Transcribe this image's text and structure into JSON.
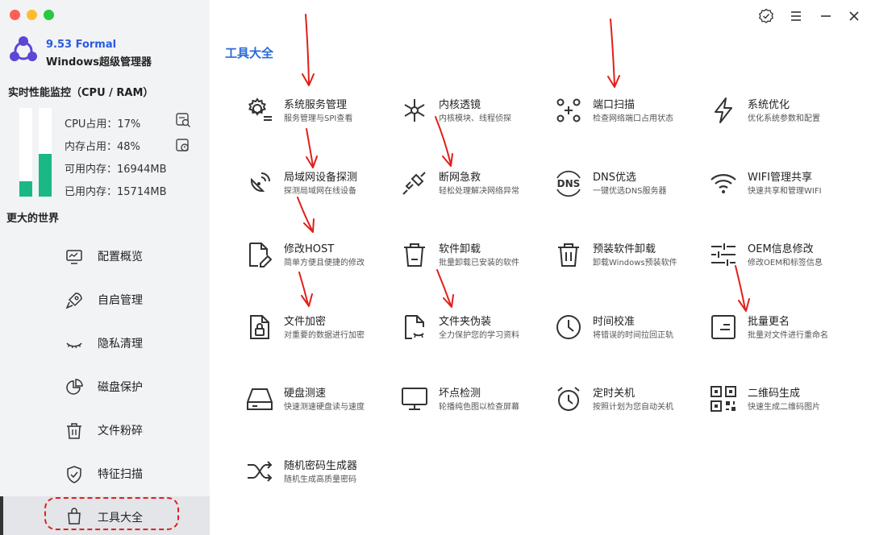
{
  "app": {
    "version": "9.53 Formal",
    "name": "Windows超级管理器"
  },
  "monitor": {
    "title": "实时性能监控（CPU / RAM）",
    "cpu_label": "CPU占用：17%",
    "cpu_percent": 17,
    "mem_label": "内存占用：48%",
    "mem_percent": 48,
    "avail_label": "可用内存：16944MB",
    "used_label": "已用内存：15714MB",
    "bar_color": "#1ab884"
  },
  "sidebar": {
    "section": "更大的世界",
    "items": [
      {
        "label": "配置概览",
        "icon": "monitor-icon"
      },
      {
        "label": "自启管理",
        "icon": "rocket-icon"
      },
      {
        "label": "隐私清理",
        "icon": "closed-eye-icon"
      },
      {
        "label": "磁盘保护",
        "icon": "pie-chart-icon"
      },
      {
        "label": "文件粉碎",
        "icon": "trash-icon"
      },
      {
        "label": "特征扫描",
        "icon": "shield-check-icon"
      },
      {
        "label": "工具大全",
        "icon": "bag-icon",
        "active": true
      }
    ]
  },
  "main": {
    "title": "工具大全",
    "tools": [
      {
        "name": "系统服务管理",
        "desc": "服务管理与SPI查看",
        "icon": "gear-list-icon"
      },
      {
        "name": "内核透镜",
        "desc": "内核模块、线程侦探",
        "icon": "kernel-icon"
      },
      {
        "name": "端口扫描",
        "desc": "检查网络端口占用状态",
        "icon": "port-scan-icon"
      },
      {
        "name": "系统优化",
        "desc": "优化系统参数和配置",
        "icon": "lightning-icon"
      },
      {
        "name": "局域网设备探测",
        "desc": "探测局域网在线设备",
        "icon": "satellite-icon"
      },
      {
        "name": "断网急救",
        "desc": "轻松处理解决网络异常",
        "icon": "plug-icon"
      },
      {
        "name": "DNS优选",
        "desc": "一键优选DNS服务器",
        "icon": "dns-icon"
      },
      {
        "name": "WIFI管理共享",
        "desc": "快速共享和管理WIFI",
        "icon": "wifi-icon"
      },
      {
        "name": "修改HOST",
        "desc": "简单方便且便捷的修改",
        "icon": "file-edit-icon"
      },
      {
        "name": "软件卸载",
        "desc": "批量卸载已安装的软件",
        "icon": "bin-icon"
      },
      {
        "name": "预装软件卸载",
        "desc": "卸载Windows预装软件",
        "icon": "bin-lines-icon"
      },
      {
        "name": "OEM信息修改",
        "desc": "修改OEM和标签信息",
        "icon": "sliders-icon"
      },
      {
        "name": "文件加密",
        "desc": "对重要的数据进行加密",
        "icon": "file-lock-icon"
      },
      {
        "name": "文件夹伪装",
        "desc": "全力保护您的学习资料",
        "icon": "file-mask-icon"
      },
      {
        "name": "时间校准",
        "desc": "将错误的时间拉回正轨",
        "icon": "clock-icon"
      },
      {
        "name": "批量更名",
        "desc": "批量对文件进行重命名",
        "icon": "rename-icon"
      },
      {
        "name": "硬盘测速",
        "desc": "快速测速硬盘读与速度",
        "icon": "harddisk-icon"
      },
      {
        "name": "坏点检测",
        "desc": "轮播纯色图以检查屏幕",
        "icon": "screen-icon"
      },
      {
        "name": "定时关机",
        "desc": "按照计划为您自动关机",
        "icon": "alarm-icon"
      },
      {
        "name": "二维码生成",
        "desc": "快速生成二维码图片",
        "icon": "qrcode-icon"
      },
      {
        "name": "随机密码生成器",
        "desc": "随机生成高质量密码",
        "icon": "shuffle-icon"
      }
    ]
  },
  "colors": {
    "accent": "#2a6ad8",
    "annotation": "#e0201a"
  }
}
